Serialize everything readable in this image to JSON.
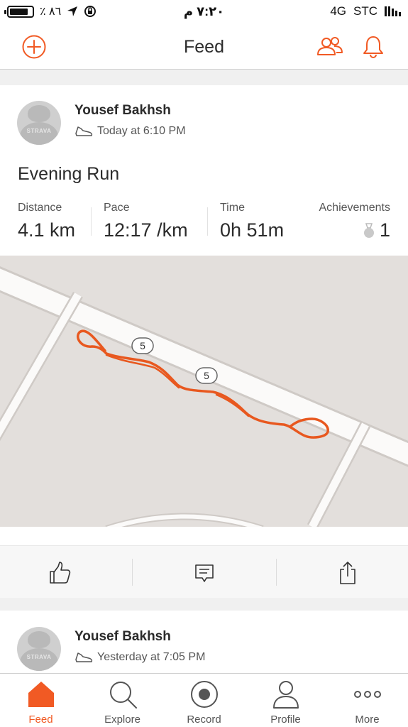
{
  "status_bar": {
    "battery_percent": "٪ ٨٦",
    "time": "٧:٢٠ م",
    "network": "4G",
    "carrier": "STC"
  },
  "nav": {
    "title": "Feed",
    "left_icon": "add-circle-icon",
    "right_icons": [
      "friends-icon",
      "bell-icon"
    ]
  },
  "colors": {
    "accent": "#f15a24",
    "route": "#e8581f"
  },
  "feed": [
    {
      "athlete_name": "Yousef Bakhsh",
      "avatar_brand": "STRAVA",
      "timestamp": "Today at 6:10 PM",
      "activity_icon": "shoe-icon",
      "title": "Evening Run",
      "stats": {
        "distance_label": "Distance",
        "distance_value": "4.1 km",
        "pace_label": "Pace",
        "pace_value": "12:17 /km",
        "time_label": "Time",
        "time_value": "0h 51m",
        "achievements_label": "Achievements",
        "achievements_value": "1"
      },
      "map": {
        "road_shield_1": "5",
        "road_shield_2": "5"
      },
      "actions": [
        "kudos-icon",
        "comment-icon",
        "share-icon"
      ]
    },
    {
      "athlete_name": "Yousef Bakhsh",
      "avatar_brand": "STRAVA",
      "timestamp": "Yesterday at 7:05 PM",
      "activity_icon": "shoe-icon"
    }
  ],
  "tab_bar": {
    "tabs": [
      {
        "label": "Feed",
        "icon": "home-icon",
        "active": true
      },
      {
        "label": "Explore",
        "icon": "search-icon",
        "active": false
      },
      {
        "label": "Record",
        "icon": "record-icon",
        "active": false
      },
      {
        "label": "Profile",
        "icon": "profile-icon",
        "active": false
      },
      {
        "label": "More",
        "icon": "more-icon",
        "active": false
      }
    ]
  }
}
